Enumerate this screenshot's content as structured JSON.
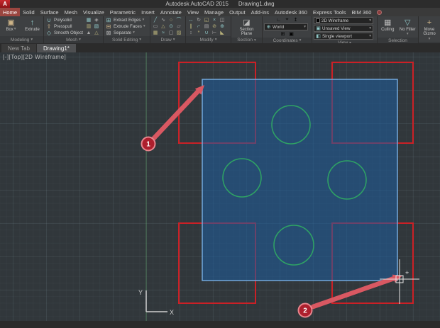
{
  "title_bar": {
    "logo_letter": "A",
    "app_title": "Autodesk AutoCAD 2015",
    "doc_title": "Drawing1.dwg"
  },
  "ribbon_tabs": [
    "Home",
    "Solid",
    "Surface",
    "Mesh",
    "Visualize",
    "Parametric",
    "Insert",
    "Annotate",
    "View",
    "Manage",
    "Output",
    "Add-ins",
    "Autodesk 360",
    "Express Tools",
    "BIM 360"
  ],
  "ribbon": {
    "modeling": {
      "label": "Modeling",
      "box": "Box",
      "extrude": "Extrude"
    },
    "mesh": {
      "label": "Mesh",
      "polysolid": "Polysolid",
      "presspull": "Presspull",
      "smooth_object": "Smooth Object"
    },
    "solid_editing": {
      "label": "Solid Editing",
      "extract_edges": "Extract Edges",
      "extrude_faces": "Extrude Faces",
      "separate": "Separate"
    },
    "draw": {
      "label": "Draw"
    },
    "modify": {
      "label": "Modify"
    },
    "section": {
      "label": "Section",
      "section_plane": "Section Plane"
    },
    "coordinates": {
      "label": "Coordinates",
      "world": "World"
    },
    "view": {
      "label": "View",
      "visual_style": "2D Wireframe",
      "named_view": "Unsaved View",
      "viewport_config": "Single viewport"
    },
    "selection": {
      "label": "Selection",
      "culling": "Culling",
      "no_filter": "No Filter"
    },
    "gizmo": {
      "move_gizmo": "Move Gizmo"
    }
  },
  "file_tabs": {
    "new_tab": "New Tab",
    "active_tab": "Drawing1*"
  },
  "canvas": {
    "viewport_controls": "[-][Top][2D Wireframe]",
    "ucs": {
      "x": "X",
      "y": "Y"
    },
    "badges": {
      "one": "1",
      "two": "2"
    },
    "plus_badge": "+"
  },
  "icons": {
    "caret": "▾",
    "box": "▣",
    "extrude": "↑",
    "polysolid": "∪",
    "presspull": "⇧",
    "smooth_object": "◇",
    "extract_edges": "⊞",
    "extrude_faces": "⊟",
    "separate": "⊠",
    "line": "╱",
    "polyline": "∿",
    "circle": "○",
    "arc": "⌒",
    "rectangle": "▭",
    "polygon": "△",
    "point": "⊙",
    "ellipse": "▱",
    "hatch": "▦",
    "spline": "≈",
    "region": "▢",
    "gradient": "▨",
    "move": "↔",
    "rotate": "↻",
    "trim": "◱",
    "erase": "×",
    "copy": "◫",
    "mirror": "∥",
    "fillet": "⌐",
    "array": "▤",
    "offset": "⊘",
    "scale": "⊕",
    "stretch": "↕",
    "explode": "*",
    "join": "∪",
    "break": "⊢",
    "chamfer": "◣",
    "mesh_box": "▦",
    "mesh_smooth": "◈",
    "mesh_face": "▥",
    "mesh_refine": "▧",
    "mesh_crease": "▲",
    "mesh_split": "△",
    "section_plane": "◪",
    "ucs": "∟",
    "ucs_origin": "⌖",
    "ucs_z": "↥",
    "world": "⊕",
    "named_view": "▣",
    "viewport": "◧",
    "culling": "▦",
    "no_filter": "▽",
    "move_gizmo": "+"
  },
  "colors": {
    "highlight_red": "#cb2026",
    "selection_fill": "rgba(30,95,160,0.55)",
    "selection_border": "#73a9dc",
    "circle_green": "#2fa464",
    "arrow_pink": "#d95862",
    "active_tab_red": "#9b4640"
  }
}
